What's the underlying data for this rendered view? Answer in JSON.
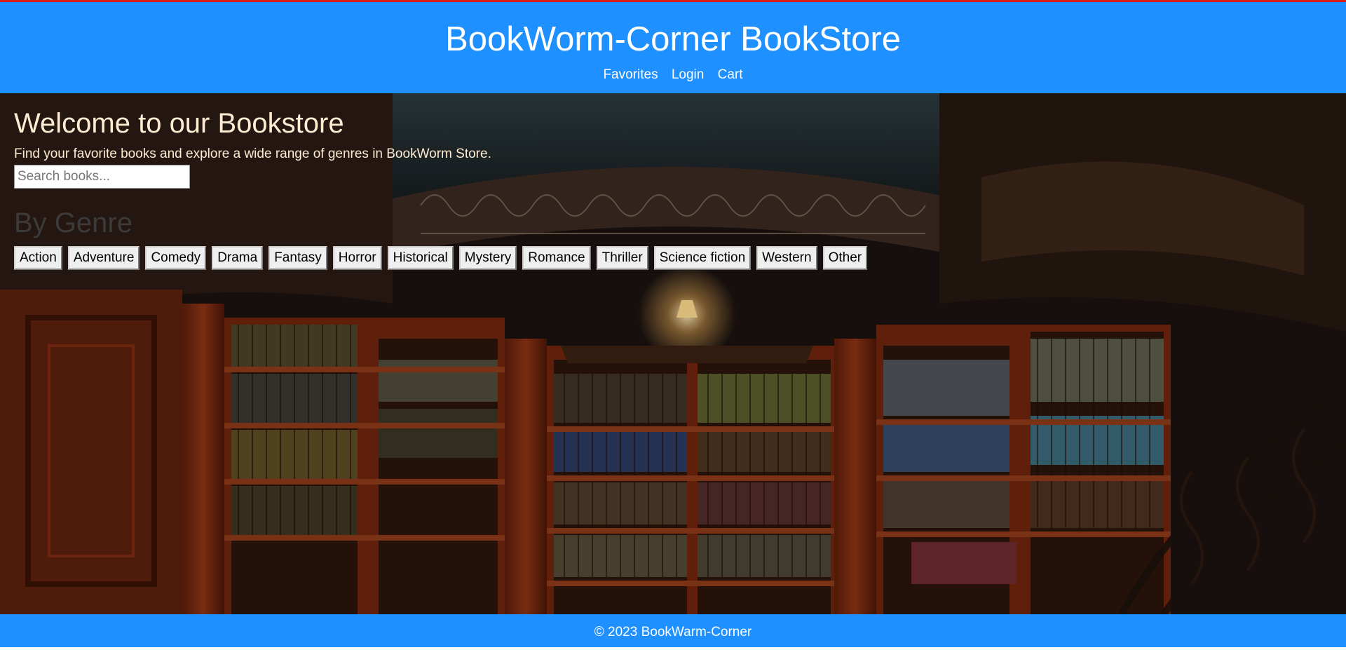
{
  "header": {
    "title": "BookWorm-Corner BookStore",
    "nav": [
      "Favorites",
      "Login",
      "Cart"
    ]
  },
  "hero": {
    "welcome_title": "Welcome to our Bookstore",
    "welcome_subtitle": "Find your favorite books and explore a wide range of genres in BookWorm Store.",
    "search_placeholder": "Search books...",
    "genre_title": "By Genre",
    "genres": [
      "Action",
      "Adventure",
      "Comedy",
      "Drama",
      "Fantasy",
      "Horror",
      "Historical",
      "Mystery",
      "Romance",
      "Thriller",
      "Science fiction",
      "Western",
      "Other"
    ],
    "background_image": "library-interior"
  },
  "footer": {
    "text": "© 2023 BookWarm-Corner"
  },
  "colors": {
    "brand_blue": "#1e90ff",
    "top_rule_red": "#d81b1b",
    "hero_text": "#fdebd2"
  }
}
